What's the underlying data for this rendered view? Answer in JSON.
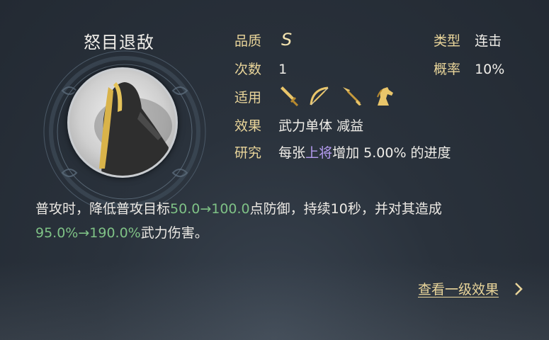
{
  "skill": {
    "name": "怒目退敌"
  },
  "info": {
    "quality_label": "品质",
    "quality_value": "S",
    "type_label": "类型",
    "type_value": "连击",
    "count_label": "次数",
    "count_value": "1",
    "rate_label": "概率",
    "rate_value": "10%",
    "applies_label": "适用",
    "applies_icons": [
      "sword-icon",
      "bow-icon",
      "spear-icon",
      "horse-icon"
    ],
    "effect_label": "效果",
    "effect_value": "武力单体 减益",
    "research_label": "研究",
    "research_prefix": "每张",
    "research_highlight": "上将",
    "research_suffix": "增加 5.00% 的进度"
  },
  "description": {
    "p1": "普攻时，降低普攻目标",
    "v1": "50.0→100.0",
    "p2": "点防御，持续10秒，并对其造成",
    "v2": "95.0%→190.0%",
    "p3": "武力伤害。"
  },
  "link": {
    "label": "查看一级效果"
  },
  "colors": {
    "label_gold": "#e9d59a",
    "highlight_purple": "#b59cf0",
    "value_green": "#7fc286"
  }
}
